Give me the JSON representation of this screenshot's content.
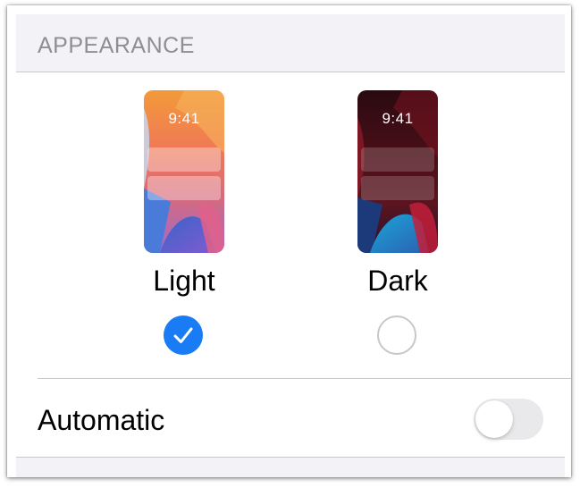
{
  "section": {
    "title": "APPEARANCE"
  },
  "options": [
    {
      "label": "Light",
      "preview_time": "9:41",
      "selected": true
    },
    {
      "label": "Dark",
      "preview_time": "9:41",
      "selected": false
    }
  ],
  "automatic": {
    "label": "Automatic",
    "enabled": false
  },
  "colors": {
    "accent_blue": "#1a7cf5",
    "section_background": "#f2f2f7",
    "section_text": "#8e8e93",
    "toggle_off": "#e9e9eb",
    "radio_border": "#c7c7cc"
  }
}
